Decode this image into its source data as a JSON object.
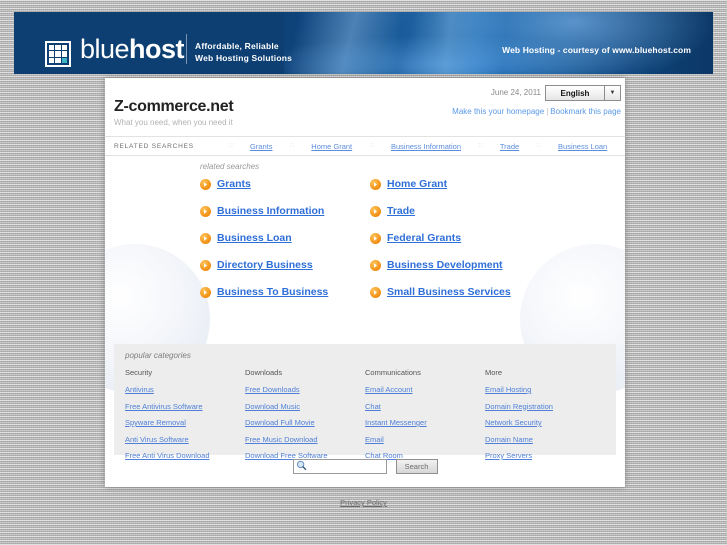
{
  "banner": {
    "logo_thin": "blue",
    "logo_bold": "host",
    "tagline_line1": "Affordable, Reliable",
    "tagline_line2": "Web Hosting Solutions",
    "right_text": "Web Hosting - courtesy of www.bluehost.com",
    "brand_color": "#0d3f73",
    "accent_color": "#3fb6c8"
  },
  "header": {
    "site_title": "Z-commerce.net",
    "site_subtitle": "What you need, when you need it",
    "date": "June 24, 2011",
    "language": "English",
    "homepage_link": "Make this your homepage",
    "bookmark_link": "Bookmark this page",
    "separator": "|"
  },
  "related_bar": {
    "label": "RELATED SEARCHES",
    "dots": "::",
    "items": [
      {
        "label": "Grants"
      },
      {
        "label": "Home Grant"
      },
      {
        "label": "Business Information"
      },
      {
        "label": "Trade"
      },
      {
        "label": "Business Loan"
      }
    ]
  },
  "main": {
    "section_label": "related searches",
    "links": [
      {
        "label": "Grants"
      },
      {
        "label": "Home Grant"
      },
      {
        "label": "Business Information"
      },
      {
        "label": "Trade"
      },
      {
        "label": "Business Loan"
      },
      {
        "label": "Federal Grants"
      },
      {
        "label": "Directory Business"
      },
      {
        "label": "Business Development"
      },
      {
        "label": "Business To Business"
      },
      {
        "label": "Small Business Services"
      }
    ],
    "link_color": "#2f6fd8",
    "bullet_color": "#f08a0c"
  },
  "categories": {
    "title": "popular categories",
    "columns": [
      {
        "heading": "Security",
        "items": [
          "Antivirus",
          "Free Antivirus Software",
          "Spyware Removal",
          "Anti Virus Software",
          "Free Anti Virus Download"
        ]
      },
      {
        "heading": "Downloads",
        "items": [
          "Free Downloads",
          "Download Music",
          "Download Full Movie",
          "Free Music Download",
          "Download Free Software"
        ]
      },
      {
        "heading": "Communications",
        "items": [
          "Email Account",
          "Chat",
          "Instant Messenger",
          "Email",
          "Chat Room"
        ]
      },
      {
        "heading": "More",
        "items": [
          "Email Hosting",
          "Domain Registration",
          "Network Security",
          "Domain Name",
          "Proxy Servers"
        ]
      }
    ]
  },
  "search": {
    "value": "",
    "placeholder": "",
    "button_label": "Search"
  },
  "footer": {
    "privacy_label": "Privacy Policy"
  }
}
